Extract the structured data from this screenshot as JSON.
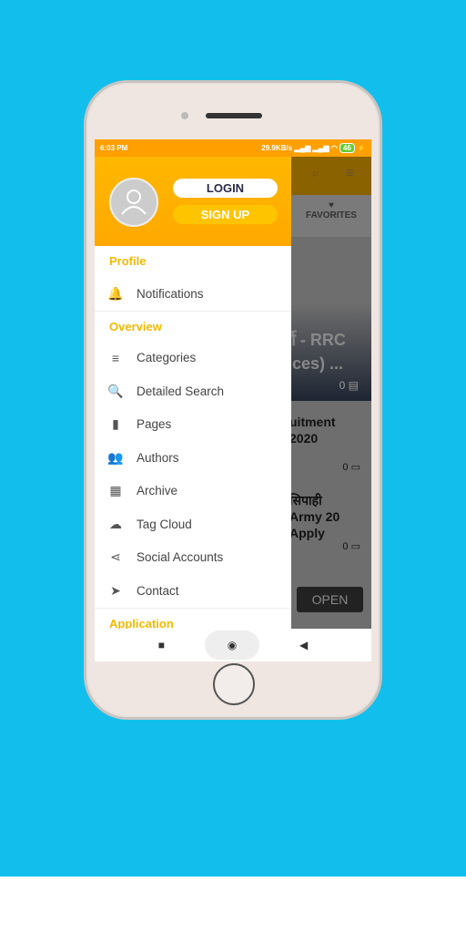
{
  "status": {
    "time": "6:03 PM",
    "speed": "29.9KB/s",
    "battery": "46"
  },
  "drawer": {
    "login": "LOGIN",
    "signup": "SIGN UP",
    "sections": [
      {
        "title": "Profile",
        "items": [
          {
            "label": "Notifications",
            "icon": "bell-icon",
            "glyph": "🔔"
          }
        ]
      },
      {
        "title": "Overview",
        "items": [
          {
            "label": "Categories",
            "icon": "menu-icon",
            "glyph": "≡"
          },
          {
            "label": "Detailed Search",
            "icon": "search-icon",
            "glyph": "🔍"
          },
          {
            "label": "Pages",
            "icon": "page-icon",
            "glyph": "▮"
          },
          {
            "label": "Authors",
            "icon": "people-icon",
            "glyph": "👥"
          },
          {
            "label": "Archive",
            "icon": "calendar-icon",
            "glyph": "▦"
          },
          {
            "label": "Tag Cloud",
            "icon": "cloud-icon",
            "glyph": "☁"
          },
          {
            "label": "Social Accounts",
            "icon": "share-icon",
            "glyph": "⋖"
          },
          {
            "label": "Contact",
            "icon": "send-icon",
            "glyph": "➤"
          }
        ]
      },
      {
        "title": "Application",
        "items": []
      }
    ]
  },
  "background_app": {
    "tab": "FAVORITES",
    "card_title": "र्ती - RRC tices) ...",
    "card_comments": "0",
    "post1": "uitment 2020",
    "post1_comments": "0",
    "post2": "सिपाही Army 20 Apply",
    "post2_comments": "0",
    "open": "OPEN"
  }
}
